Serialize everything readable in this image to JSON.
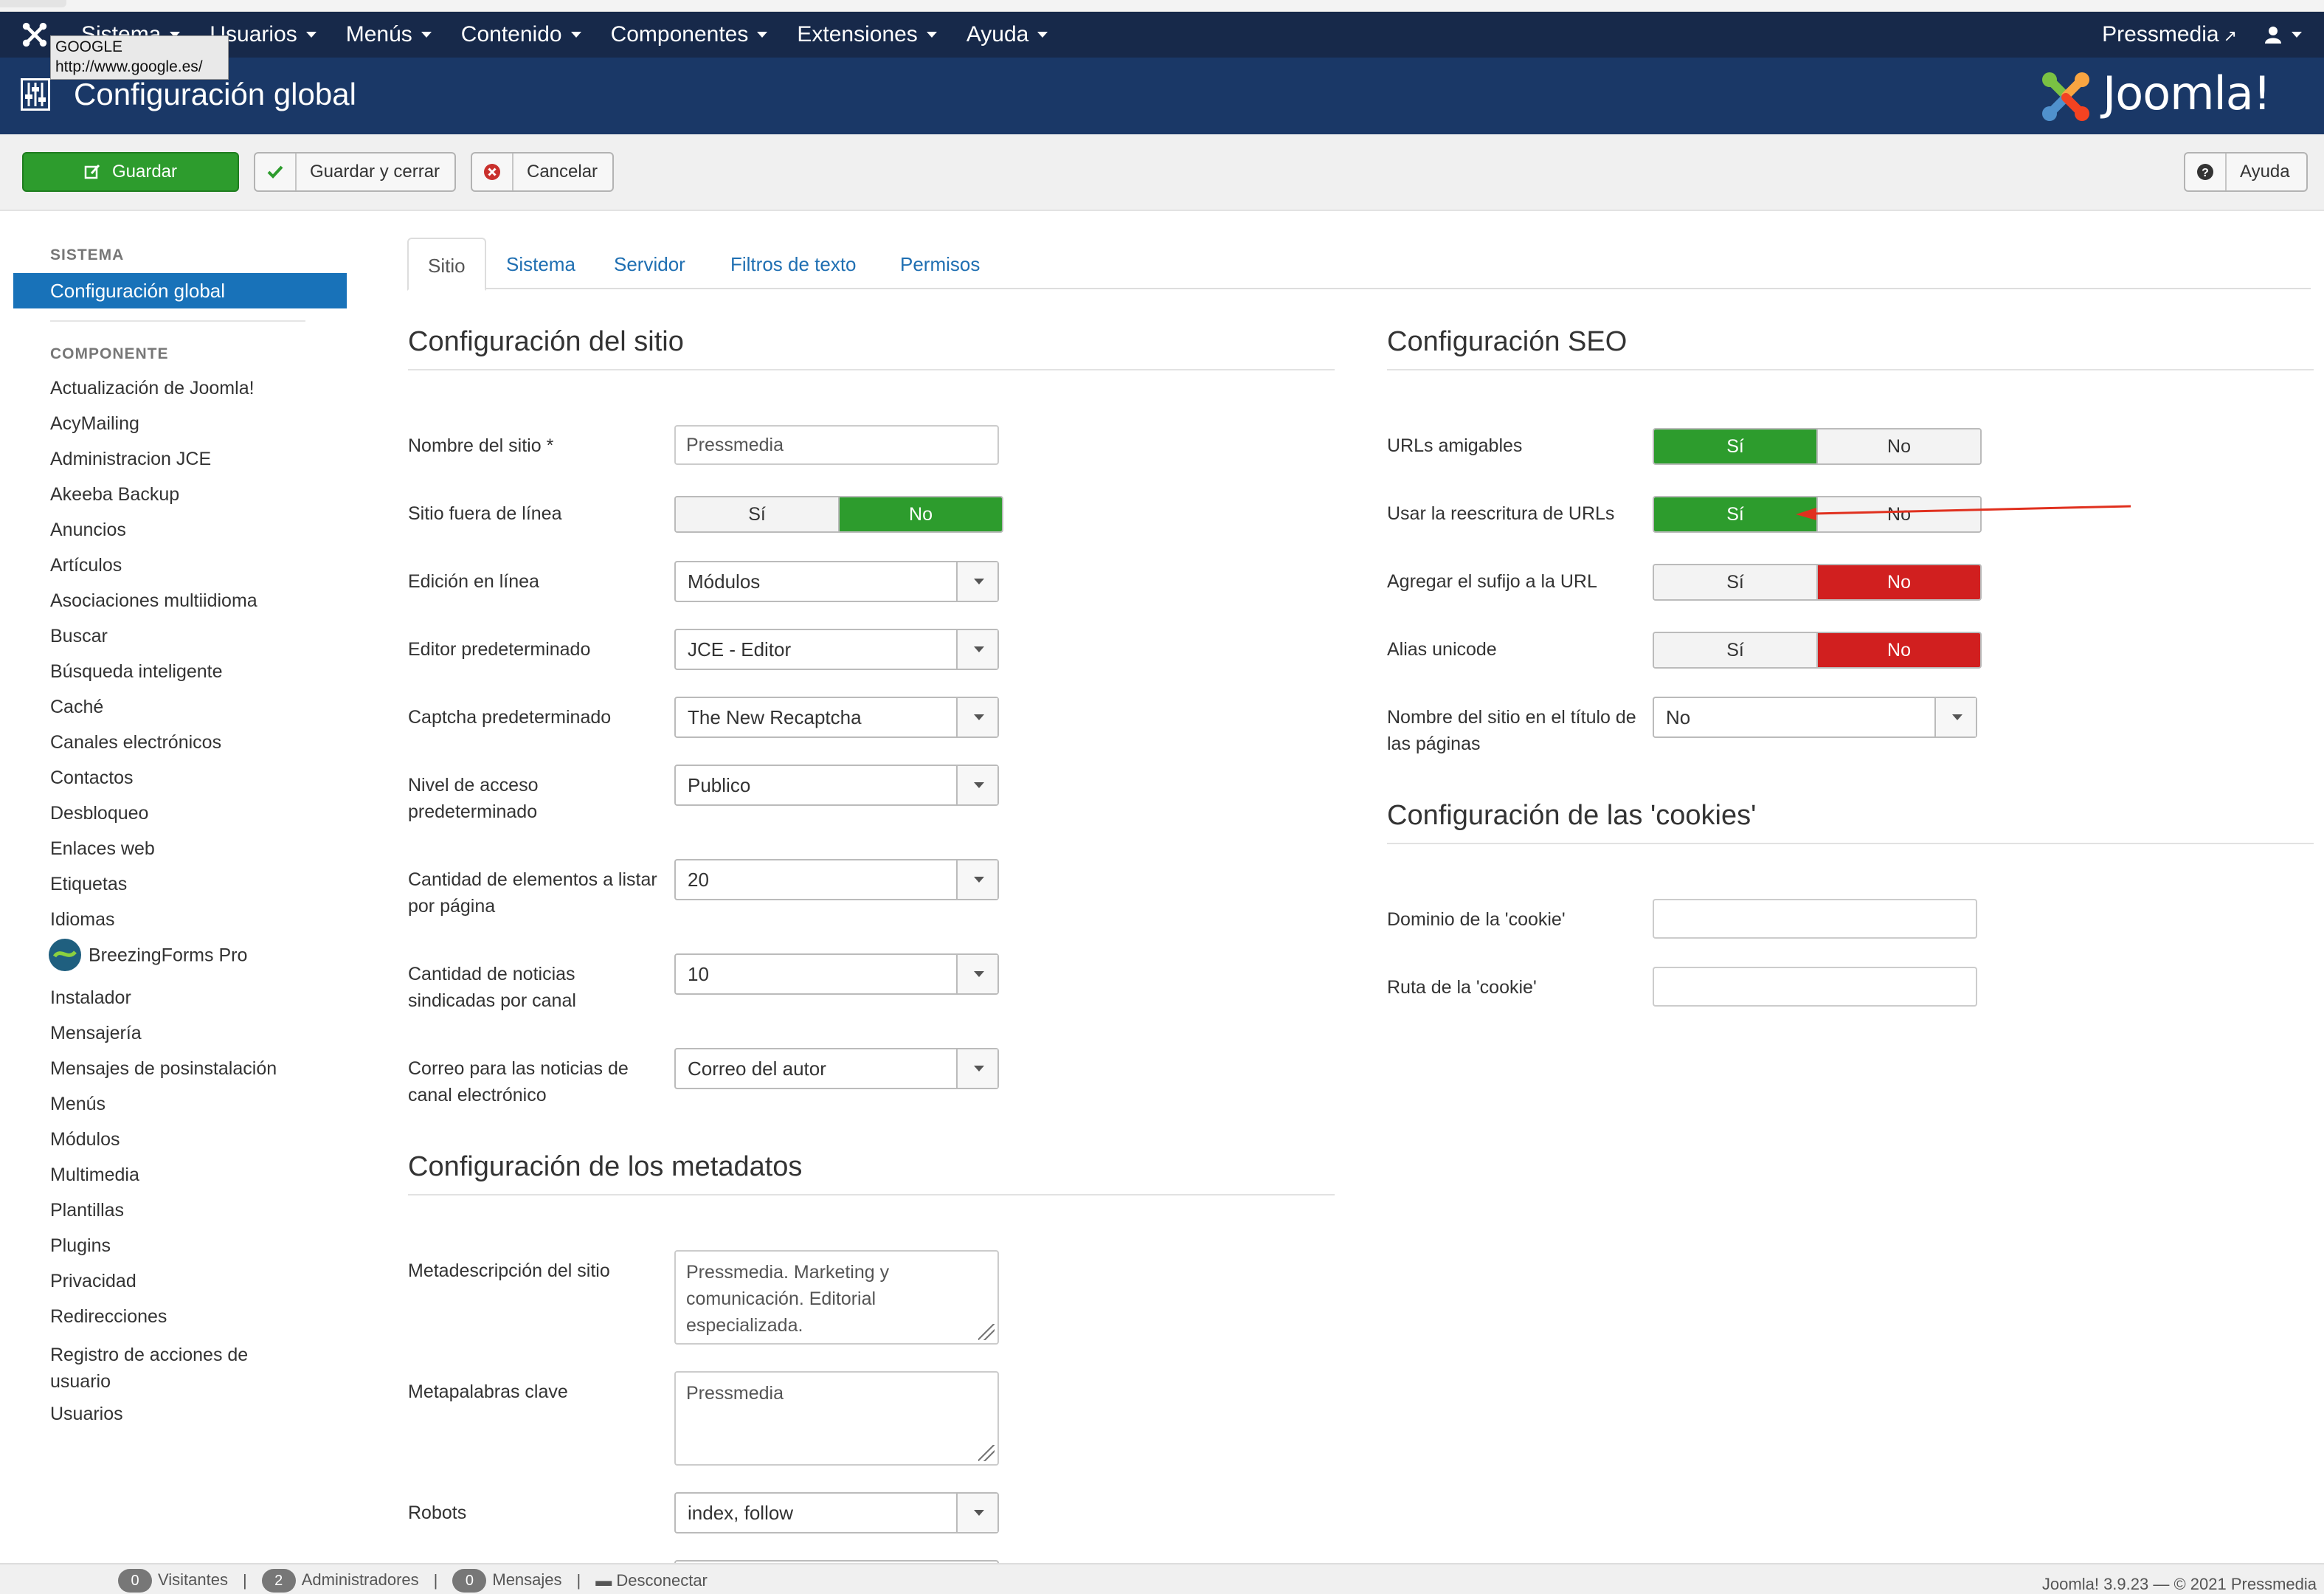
{
  "nav": {
    "items": [
      "Sistema",
      "Usuarios",
      "Menús",
      "Contenido",
      "Componentes",
      "Extensiones",
      "Ayuda"
    ],
    "site_link": "Pressmedia"
  },
  "tooltip": {
    "title": "GOOGLE",
    "url": "http://www.google.es/"
  },
  "header": {
    "title": "Configuración global",
    "brand": "Joomla!"
  },
  "toolbar": {
    "save": "Guardar",
    "save_close": "Guardar y cerrar",
    "cancel": "Cancelar",
    "help": "Ayuda"
  },
  "sidebar": {
    "system_heading": "SISTEMA",
    "active_item": "Configuración global",
    "component_heading": "COMPONENTE",
    "items": [
      "Actualización de Joomla!",
      "AcyMailing",
      "Administracion JCE",
      "Akeeba Backup",
      "Anuncios",
      "Artículos",
      "Asociaciones multiidioma",
      "Buscar",
      "Búsqueda inteligente",
      "Caché",
      "Canales electrónicos",
      "Contactos",
      "Desbloqueo",
      "Enlaces web",
      "Etiquetas",
      "Idiomas",
      "BreezingForms Pro",
      "Instalador",
      "Mensajería",
      "Mensajes de posinstalación",
      "Menús",
      "Módulos",
      "Multimedia",
      "Plantillas",
      "Plugins",
      "Privacidad",
      "Redirecciones",
      "Registro de acciones de usuario",
      "Usuarios"
    ]
  },
  "tabs": [
    "Sitio",
    "Sistema",
    "Servidor",
    "Filtros de texto",
    "Permisos"
  ],
  "site": {
    "title": "Configuración del sitio",
    "site_name_label": "Nombre del sitio *",
    "site_name_value": "Pressmedia",
    "offline_label": "Sitio fuera de línea",
    "yes": "Sí",
    "no": "No",
    "frontend_edit_label": "Edición en línea",
    "frontend_edit_value": "Módulos",
    "editor_label": "Editor predeterminado",
    "editor_value": "JCE - Editor",
    "captcha_label": "Captcha predeterminado",
    "captcha_value": "The New Recaptcha",
    "access_label": "Nivel de acceso predeterminado",
    "access_value": "Publico",
    "list_limit_label": "Cantidad de elementos a listar por página",
    "list_limit_value": "20",
    "feed_limit_label": "Cantidad de noticias sindicadas por canal",
    "feed_limit_value": "10",
    "feed_email_label": "Correo para las noticias de canal electrónico",
    "feed_email_value": "Correo del autor"
  },
  "meta": {
    "title": "Configuración de los metadatos",
    "desc_label": "Metadescripción del sitio",
    "desc_value": "Pressmedia. Marketing y comunicación. Editorial especializada.",
    "keys_label": "Metapalabras clave",
    "keys_value": "Pressmedia",
    "robots_label": "Robots",
    "robots_value": "index, follow"
  },
  "seo": {
    "title": "Configuración SEO",
    "sef_label": "URLs amigables",
    "rewrite_label": "Usar la reescritura de URLs",
    "suffix_label": "Agregar el sufijo a la URL",
    "unicode_label": "Alias unicode",
    "sitename_pages_label": "Nombre del sitio en el título de las páginas",
    "sitename_pages_value": "No"
  },
  "cookies": {
    "title": "Configuración de las 'cookies'",
    "domain_label": "Dominio de la 'cookie'",
    "path_label": "Ruta de la 'cookie'"
  },
  "footer": {
    "visitors_count": "0",
    "visitors": "Visitantes",
    "admins_count": "2",
    "admins": "Administradores",
    "messages_count": "0",
    "messages": "Mensajes",
    "logout": "Desconectar",
    "version": "Joomla! 3.9.23  —  © 2021 Pressmedia"
  },
  "colors": {
    "nav": "#17294a",
    "header": "#1a3867",
    "green": "#2d9c2d",
    "red": "#d11f1f",
    "link": "#1f6fb2",
    "arrow": "#e0301e"
  }
}
